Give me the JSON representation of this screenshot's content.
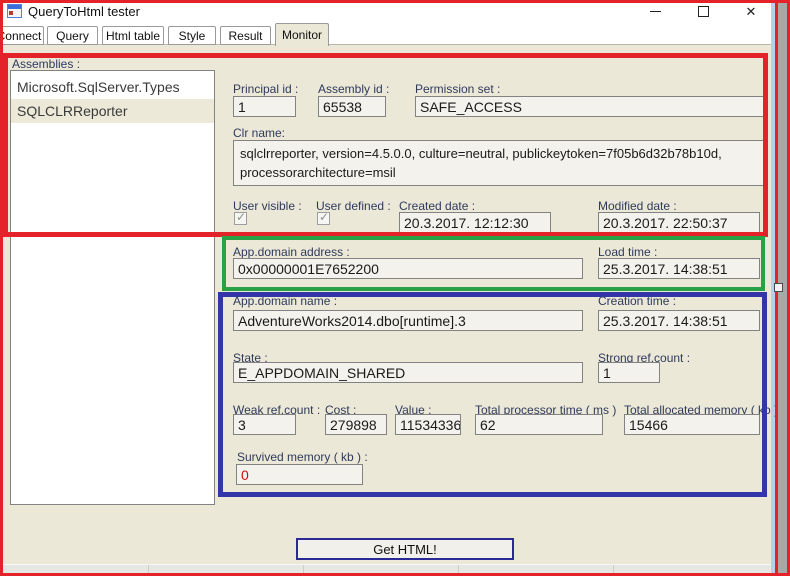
{
  "window": {
    "title": "QueryToHtml tester"
  },
  "tabs": {
    "items": [
      "Connect",
      "Query",
      "Html table",
      "Style",
      "Result",
      "Monitor"
    ],
    "selected": "Monitor"
  },
  "assemblies": {
    "label": "Assemblies :",
    "items": [
      "Microsoft.SqlServer.Types",
      "SQLCLRReporter"
    ],
    "selected": "SQLCLRReporter"
  },
  "assembly": {
    "principal_id": {
      "label": "Principal id :",
      "value": "1"
    },
    "assembly_id": {
      "label": "Assembly id :",
      "value": "65538"
    },
    "permission_set": {
      "label": "Permission set :",
      "value": "SAFE_ACCESS"
    },
    "clr_name": {
      "label": "Clr name:",
      "value": "sqlclrreporter, version=4.5.0.0, culture=neutral, publickeytoken=7f05b6d32b78b10d, processorarchitecture=msil"
    },
    "user_visible": {
      "label": "User visible :",
      "checked": true,
      "mark": "✓"
    },
    "user_defined": {
      "label": "User defined :",
      "checked": true,
      "mark": "✓"
    },
    "created_date": {
      "label": "Created date :",
      "value": "20.3.2017. 12:12:30"
    },
    "modified_date": {
      "label": "Modified date :",
      "value": "20.3.2017. 22:50:37"
    }
  },
  "appdomain": {
    "address": {
      "label": "App.domain address :",
      "value": "0x00000001E7652200"
    },
    "load_time": {
      "label": "Load time :",
      "value": "25.3.2017. 14:38:51"
    },
    "name": {
      "label": "App.domain name :",
      "value": "AdventureWorks2014.dbo[runtime].3"
    },
    "creation_time": {
      "label": "Creation time :",
      "value": "25.3.2017. 14:38:51"
    },
    "state": {
      "label": "State :",
      "value": "E_APPDOMAIN_SHARED"
    },
    "strong_ref_count": {
      "label": "Strong ref.count :",
      "value": "1"
    },
    "weak_ref_count": {
      "label": "Weak ref.count :",
      "value": "3"
    },
    "cost": {
      "label": "Cost :",
      "value": "279898"
    },
    "value": {
      "label": "Value :",
      "value": "11534336"
    },
    "total_processor_time": {
      "label": "Total processor time ( ms )",
      "value": "62"
    },
    "total_allocated_memory": {
      "label": "Total allocated memory ( kb )",
      "value": "15466"
    },
    "survived_memory": {
      "label": "Survived memory ( kb ) :",
      "value": "0",
      "value_color": "#cc1111"
    }
  },
  "footer": {
    "get_html": "Get HTML!"
  },
  "colors": {
    "annotation_red": "#e4222a",
    "annotation_green": "#28a244",
    "annotation_blue": "#3336a8",
    "form_background": "#ece8d8"
  }
}
